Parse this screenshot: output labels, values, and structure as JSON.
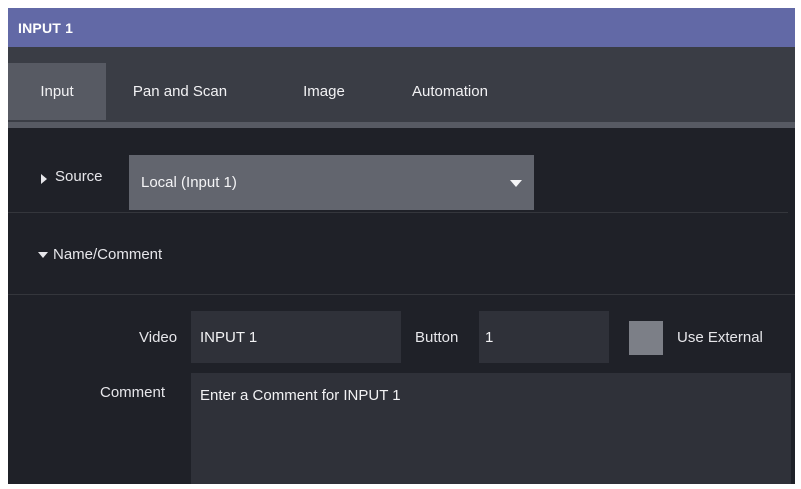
{
  "window": {
    "title": "INPUT 1"
  },
  "tabs": [
    {
      "label": "Input",
      "active": true
    },
    {
      "label": "Pan and Scan",
      "active": false
    },
    {
      "label": "Image",
      "active": false
    },
    {
      "label": "Automation",
      "active": false
    }
  ],
  "source": {
    "label": "Source",
    "selected_value": "Local (Input 1)",
    "expanded": false
  },
  "name_comment": {
    "section_label": "Name/Comment",
    "expanded": true,
    "video_label": "Video",
    "video_value": "INPUT 1",
    "button_label": "Button",
    "button_value": "1",
    "use_external_label": "Use External",
    "use_external_checked": false,
    "comment_label": "Comment",
    "comment_placeholder": "Enter a Comment for INPUT 1"
  },
  "colors": {
    "titlebar": "#6269a6",
    "background": "#1f2128",
    "tabbar": "#3a3d45",
    "active_tab": "#575a63",
    "field": "#2f3139",
    "dropdown": "#62656e"
  }
}
